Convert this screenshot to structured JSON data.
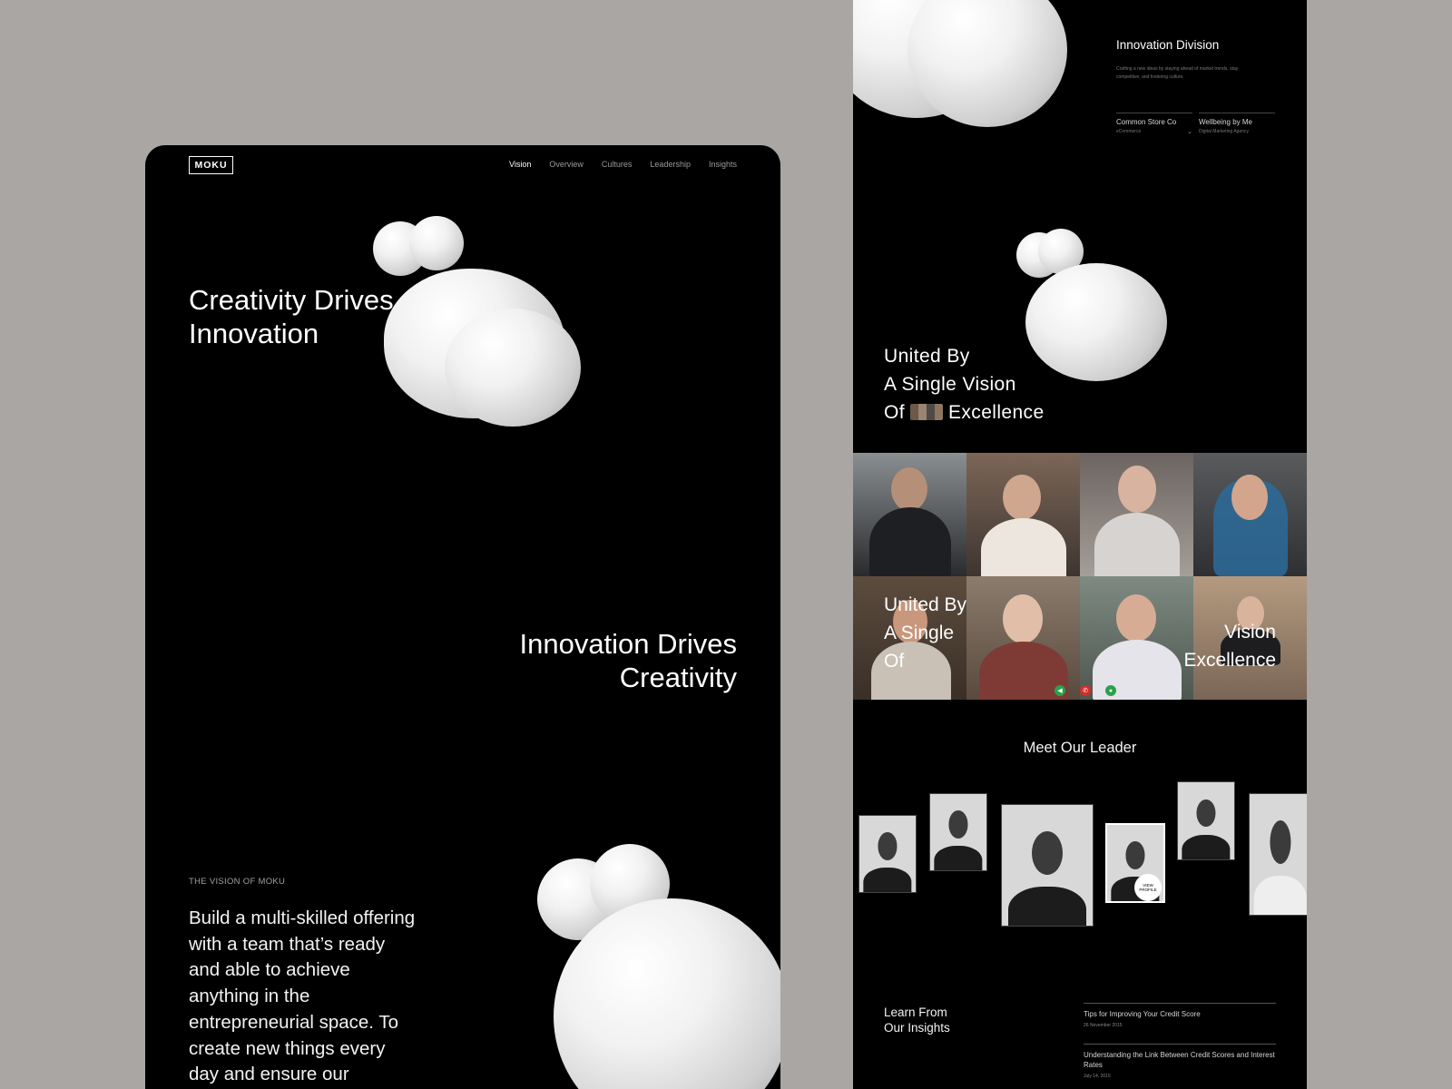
{
  "left": {
    "logo": "MOKU",
    "nav": [
      "Vision",
      "Overview",
      "Cultures",
      "Leadership",
      "Insights"
    ],
    "hero_line1": "Creativity Drives",
    "hero_line2": "Innovation",
    "second_line1": "Innovation Drives",
    "second_line2": "Creativity",
    "eyebrow": "THE VISION OF MOKU",
    "body": "Build a multi-skilled offering with a team that’s ready and able to achieve anything in the entrepreneurial space. To create new things every day and ensure our"
  },
  "right": {
    "division_title": "Innovation Division",
    "division_desc": "Crafting a new ideas by staying ahead of market trends, stay competitive, and fostering culture.",
    "col1_title": "Common Store Co",
    "col1_sub": "eCommerce",
    "col2_title": "Wellbeing by Me",
    "col2_sub": "Digital Marketing Agency",
    "united_l1": "United By",
    "united_l2": "A Single  Vision",
    "united_l3_a": "Of",
    "united_l3_b": "Excellence",
    "overlay_l1": "United By",
    "overlay_l2": "A Single",
    "overlay_l3": "Of",
    "overlay_r1": "Vision",
    "overlay_r2": "Excellence",
    "meet": "Meet Our Leader",
    "view_profile": "VIEW PROFILE",
    "learn_l1": "Learn From",
    "learn_l2": "Our Insights",
    "insights": [
      {
        "title": "Tips for Improving Your Credit Score",
        "date": "26 November 2015"
      },
      {
        "title": "Understanding the Link Between Credit Scores and Interest Rates",
        "date": "July 14, 2015"
      }
    ]
  },
  "colors": {
    "background": "#a9a6a3",
    "panel": "#000000",
    "text": "#ffffff"
  }
}
